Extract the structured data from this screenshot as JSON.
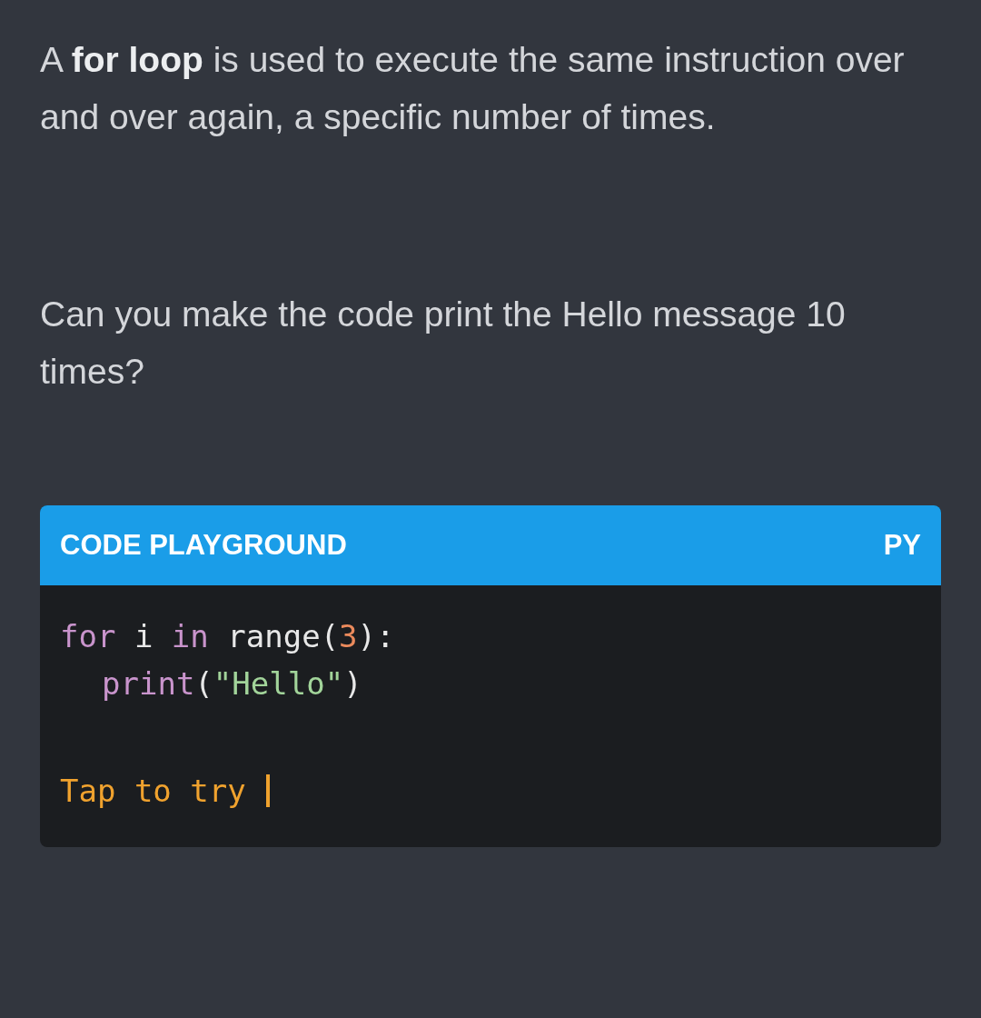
{
  "paragraphs": [
    "A **for loop** is used to execute the same instruction over and over again, a specific number of times.",
    "Can you make the code print the Hello message 10 times?"
  ],
  "playground": {
    "title": "CODE PLAYGROUND",
    "language": "PY",
    "lines": [
      {
        "indented": false,
        "tokens": [
          {
            "kind": "keyword",
            "text": "for"
          },
          {
            "kind": "plain",
            "text": " i "
          },
          {
            "kind": "keyword",
            "text": "in"
          },
          {
            "kind": "plain",
            "text": " range"
          },
          {
            "kind": "punct",
            "text": "("
          },
          {
            "kind": "number",
            "text": "3"
          },
          {
            "kind": "punct",
            "text": "):"
          }
        ]
      },
      {
        "indented": true,
        "tokens": [
          {
            "kind": "keyword",
            "text": "print"
          },
          {
            "kind": "punct",
            "text": "("
          },
          {
            "kind": "string",
            "text": "\"Hello\""
          },
          {
            "kind": "punct",
            "text": ")"
          }
        ]
      }
    ],
    "hint": {
      "text": "Tap to try",
      "cursor": true
    }
  }
}
